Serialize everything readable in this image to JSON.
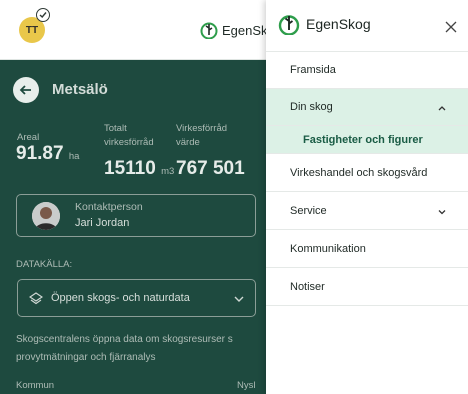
{
  "header": {
    "avatar_initials": "TT",
    "brand": "EgenSk",
    "logo_icon": "egenskog-logo-icon"
  },
  "page": {
    "title": "Metsälö",
    "stats": {
      "areal_label": "Areal",
      "areal_value": "91.87",
      "areal_unit": "ha",
      "volume_label_1": "Totalt",
      "volume_label_2": "virkesförråd",
      "volume_value": "15110",
      "volume_unit": "m3",
      "value_label_1": "Virkesförråd",
      "value_label_2": "värde",
      "value_value": "767 501"
    },
    "contact": {
      "label": "Kontaktperson",
      "name": "Jari Jordan"
    },
    "datasource": {
      "label": "DATAKÄLLA:",
      "selected": "Öppen skogs- och naturdata"
    },
    "description_line1": "Skogscentralens öppna data om skogsresurser s",
    "description_line2": "provytmätningar och fjärranalys",
    "kommun_label": "Kommun",
    "nysl_label": "Nysl"
  },
  "drawer": {
    "brand": "EgenSkog",
    "items": [
      {
        "label": "Framsida"
      },
      {
        "label": "Din skog",
        "expanded": true
      },
      {
        "label": "Fastigheter och figurer",
        "sub": true
      },
      {
        "label": "Virkeshandel och skogsvård"
      },
      {
        "label": "Service"
      },
      {
        "label": "Kommunikation"
      },
      {
        "label": "Notiser"
      }
    ]
  },
  "colors": {
    "brand_green": "#1a5c45",
    "active_bg": "#dcf1e6",
    "logo_green": "#2e9d4b"
  }
}
